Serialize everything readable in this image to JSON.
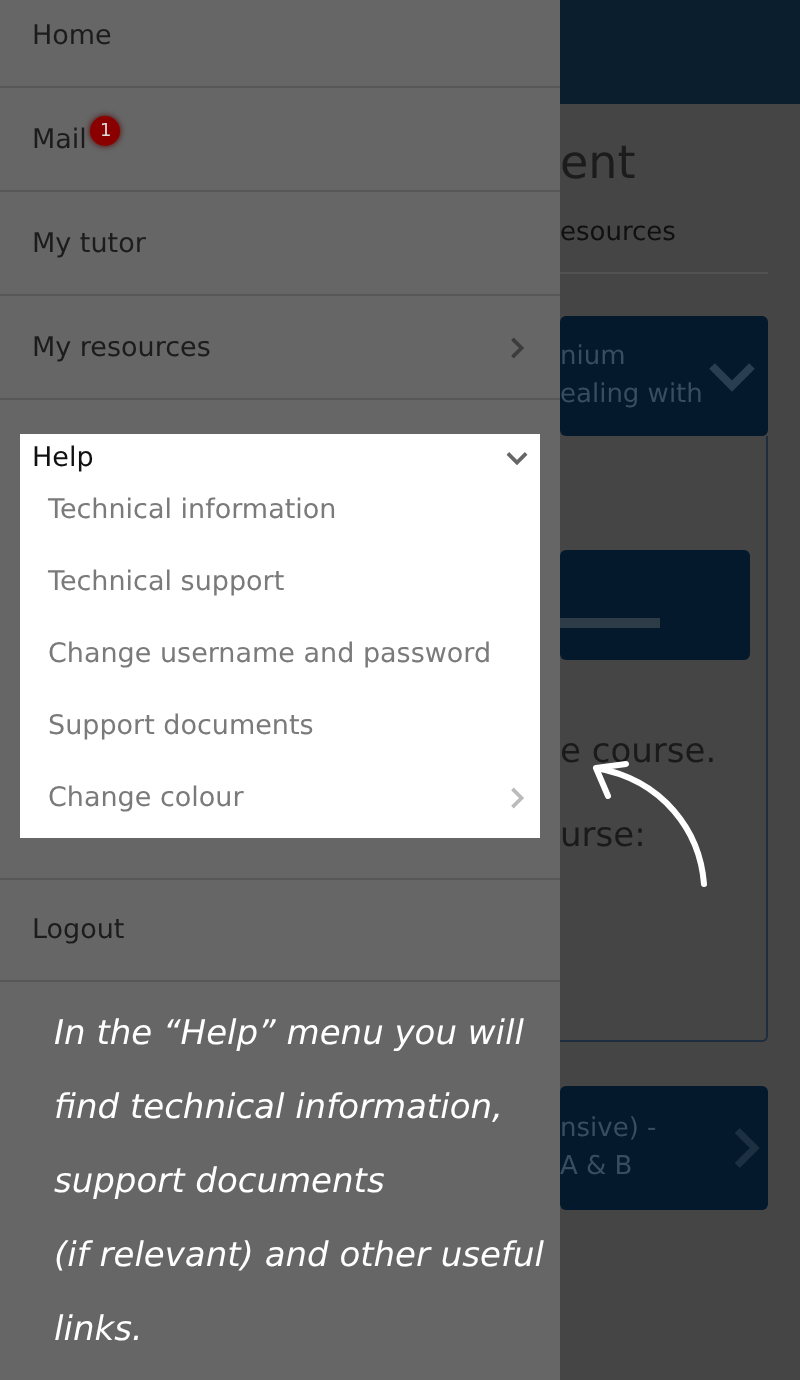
{
  "drawer": {
    "items": [
      {
        "label": "Home",
        "kind": "link",
        "highlighted": false
      },
      {
        "label": "Mail",
        "kind": "link",
        "badge": "1",
        "highlighted": false
      },
      {
        "label": "My tutor",
        "kind": "link",
        "highlighted": false
      },
      {
        "label": "My resources",
        "kind": "submenu",
        "expanded": false,
        "highlighted": false
      },
      {
        "label": "Help",
        "kind": "submenu",
        "expanded": true,
        "highlighted": true,
        "children": [
          {
            "label": "Technical information",
            "kind": "link"
          },
          {
            "label": "Technical support",
            "kind": "link"
          },
          {
            "label": "Change username and password",
            "kind": "link"
          },
          {
            "label": "Support documents",
            "kind": "link"
          },
          {
            "label": "Change colour",
            "kind": "submenu",
            "expanded": false
          }
        ]
      },
      {
        "label": "Logout",
        "kind": "link",
        "highlighted": false
      }
    ]
  },
  "background_page": {
    "heading": "ent",
    "subheading": "esources",
    "card_1": {
      "lines": [
        "nium",
        "ealing with"
      ]
    },
    "texts": [
      "e course.",
      "urse:"
    ],
    "card_3": {
      "lines": [
        "nsive) -",
        "A & B"
      ]
    }
  },
  "callout": {
    "text": "In the “Help” menu you will\nfind technical information,\nsupport documents\n(if relevant) and other useful\nlinks."
  }
}
